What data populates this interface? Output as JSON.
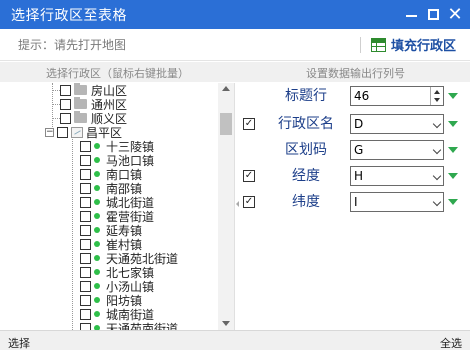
{
  "window": {
    "title": "选择行政区至表格",
    "minimize_icon": "minimize-icon",
    "maximize_icon": "maximize-icon",
    "close_icon": "close-icon",
    "title_bg": "#2b6fd6"
  },
  "toolbar": {
    "hint": "提示：请先打开地图",
    "fill_label": "填充行政区",
    "fill_icon": "table-icon"
  },
  "headers": {
    "left": "选择行政区（鼠标右键批量）",
    "right": "设置数据输出行列号"
  },
  "tree": {
    "districts": [
      "房山区",
      "通州区",
      "顺义区",
      "昌平区"
    ],
    "towns": [
      "十三陵镇",
      "马池口镇",
      "南口镇",
      "南邵镇",
      "城北街道",
      "霍营街道",
      "延寿镇",
      "崔村镇",
      "天通苑北街道",
      "北七家镇",
      "小汤山镇",
      "阳坊镇",
      "城南街道",
      "天通苑南街道"
    ],
    "dot_color": "#2fbf4a"
  },
  "form": {
    "title_row": {
      "label": "标题行",
      "value": "46",
      "checked": false
    },
    "rows": [
      {
        "label": "行政区名",
        "value": "D",
        "checked": true
      },
      {
        "label": "区划码",
        "value": "G",
        "checked": false
      },
      {
        "label": "经度",
        "value": "H",
        "checked": true
      },
      {
        "label": "纬度",
        "value": "I",
        "checked": true
      }
    ],
    "label_color": "#1d3f8a",
    "arrow_color": "#2fa84f"
  },
  "status": {
    "left": "选择",
    "right": "全选"
  }
}
